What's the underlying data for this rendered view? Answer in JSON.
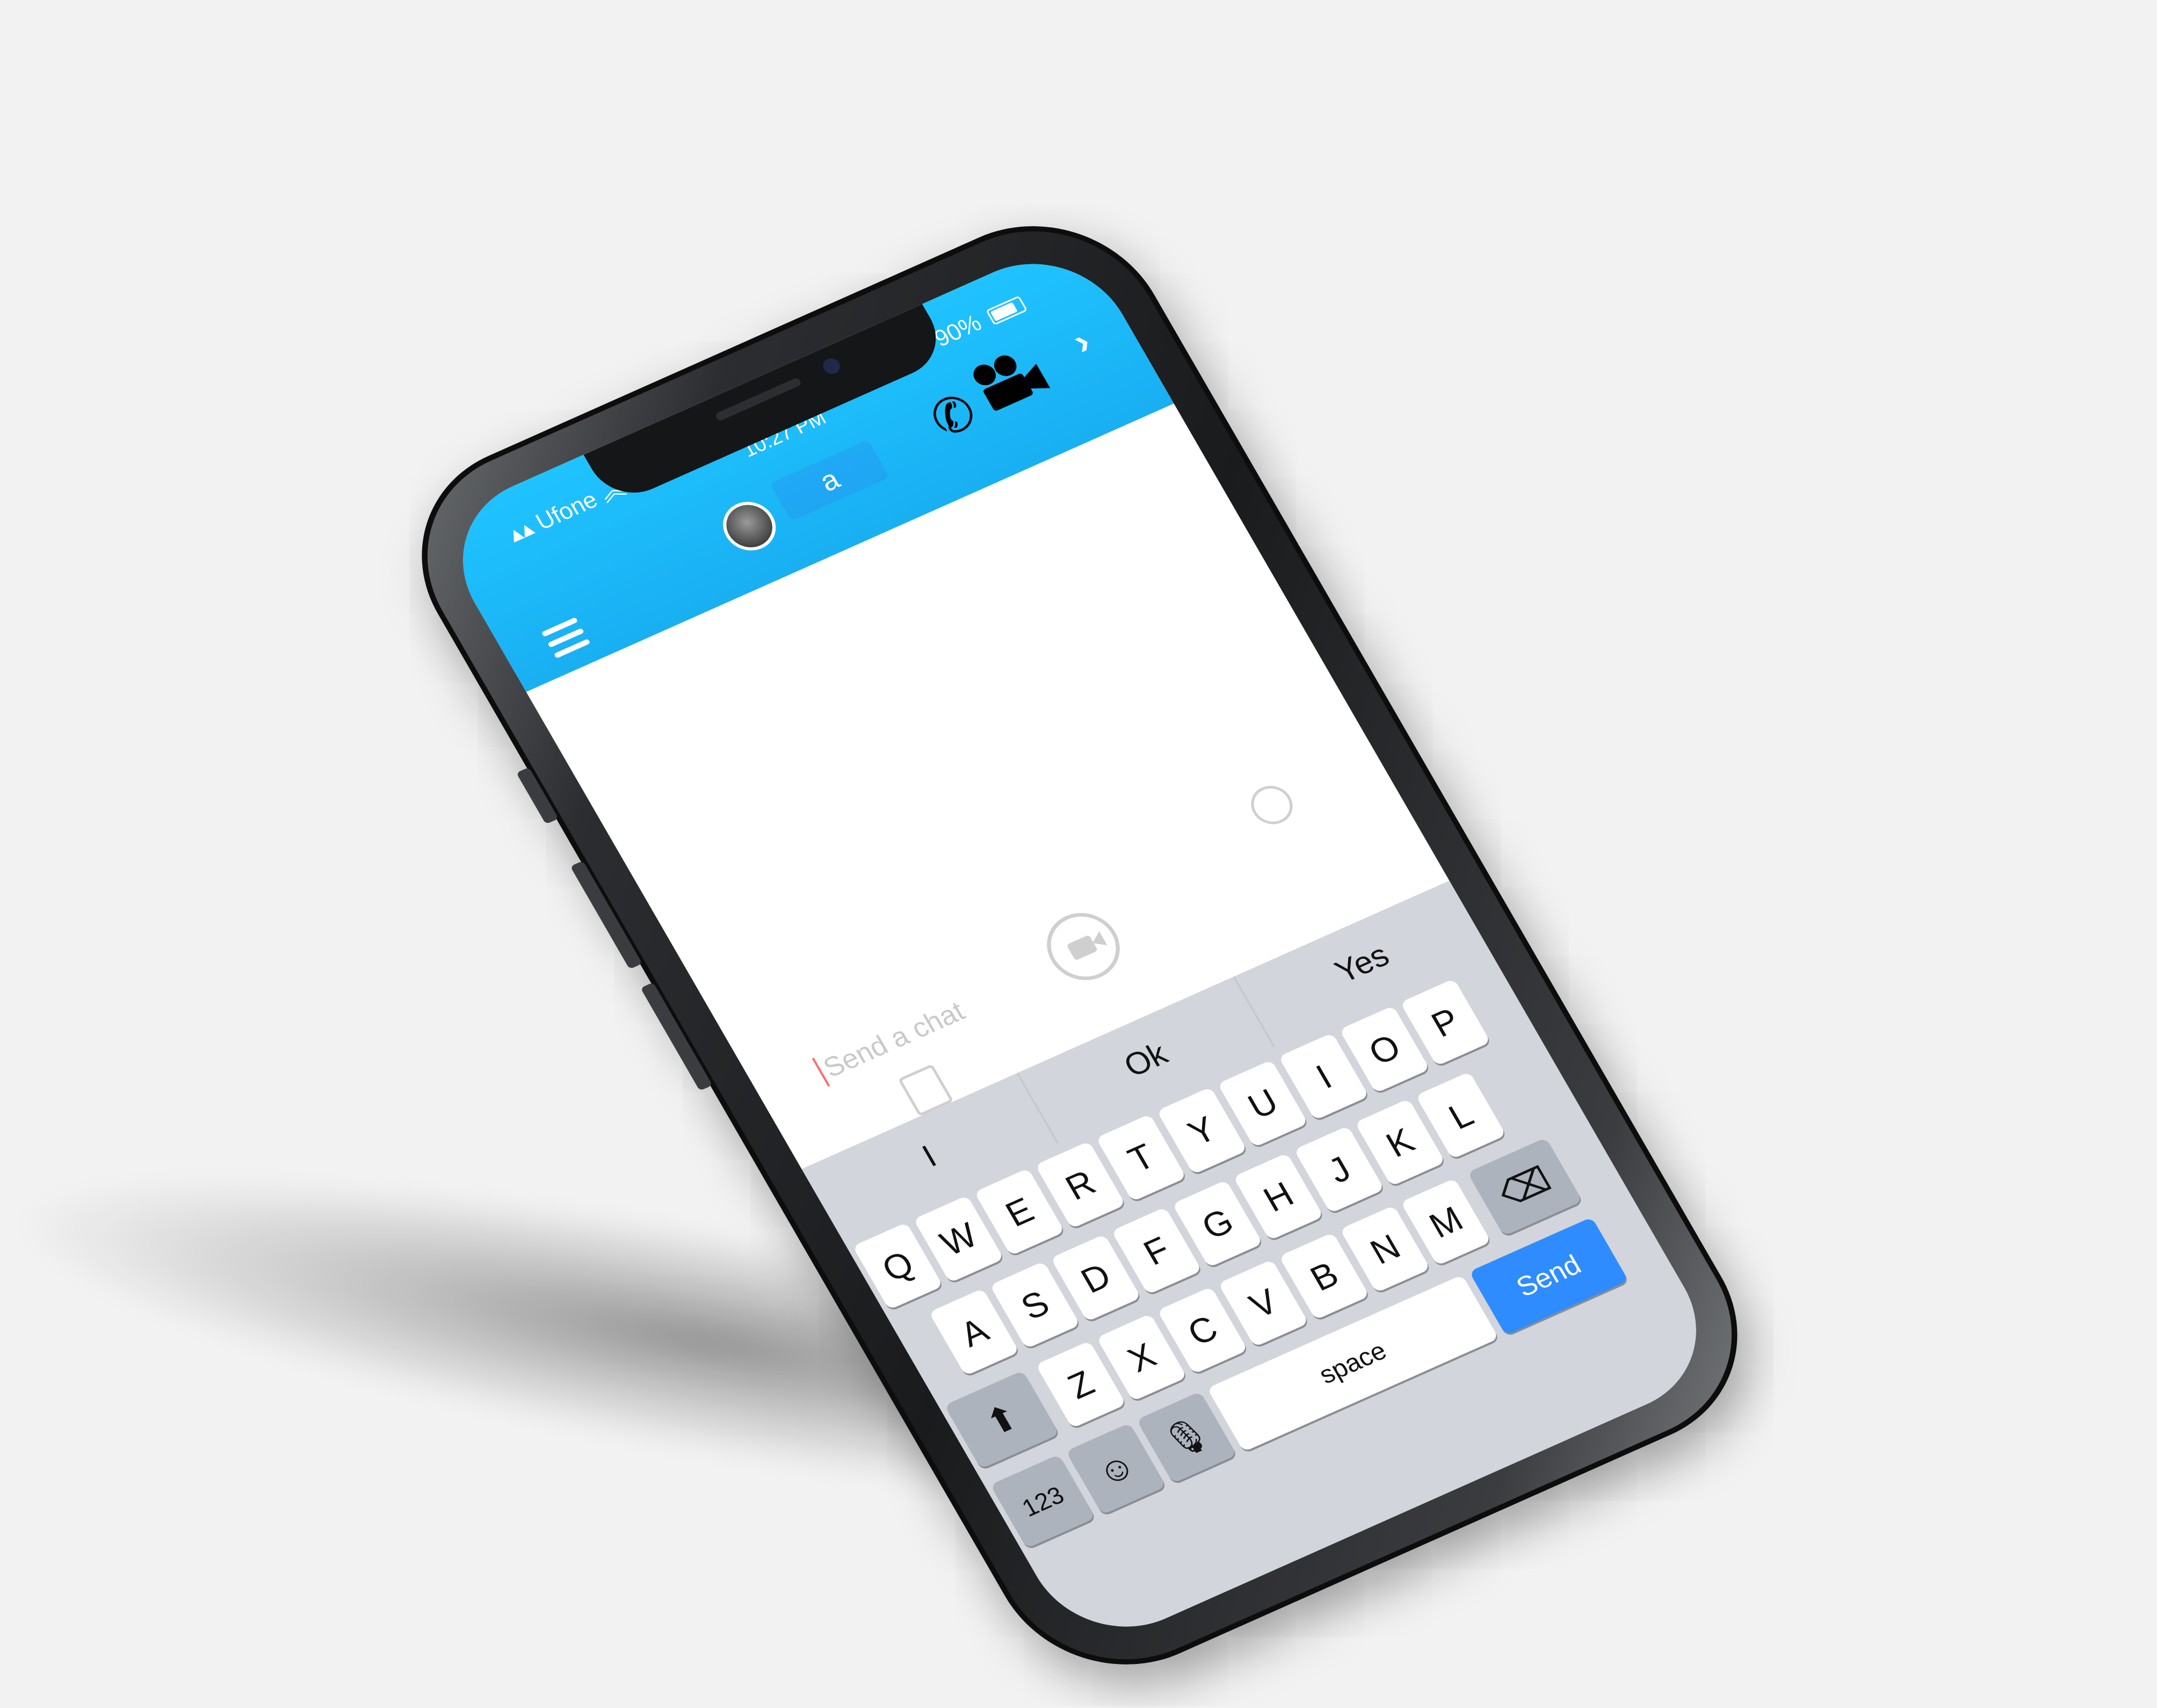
{
  "status_bar": {
    "carrier": "Ufone",
    "time": "10:27 PM",
    "battery": "90%",
    "battery_level": 0.9
  },
  "chat_header": {
    "contact_name": "a",
    "icons": [
      "menu-icon",
      "avatar",
      "phone-call-icon",
      "video-call-icon",
      "chevron-right-icon"
    ]
  },
  "compose": {
    "placeholder": "Send a chat",
    "icons": [
      "emoji-icon",
      "video-note-icon",
      "memories-icon"
    ]
  },
  "keyboard": {
    "suggestions": [
      "I",
      "Ok",
      "Yes"
    ],
    "row1": [
      "Q",
      "W",
      "E",
      "R",
      "T",
      "Y",
      "U",
      "I",
      "O",
      "P"
    ],
    "row2": [
      "A",
      "S",
      "D",
      "F",
      "G",
      "H",
      "J",
      "K",
      "L"
    ],
    "row3": [
      "Z",
      "X",
      "C",
      "V",
      "B",
      "N",
      "M"
    ],
    "shift_icon": "shift-icon",
    "backspace_icon": "backspace-icon",
    "numbers_label": "123",
    "emoji_icon": "emoji-keyboard-icon",
    "mic_icon": "microphone-icon",
    "space_label": "space",
    "send_label": "Send"
  },
  "colors": {
    "header": "#19aff2",
    "send_key": "#2f8cff",
    "keyboard_bg": "#d2d5db"
  }
}
